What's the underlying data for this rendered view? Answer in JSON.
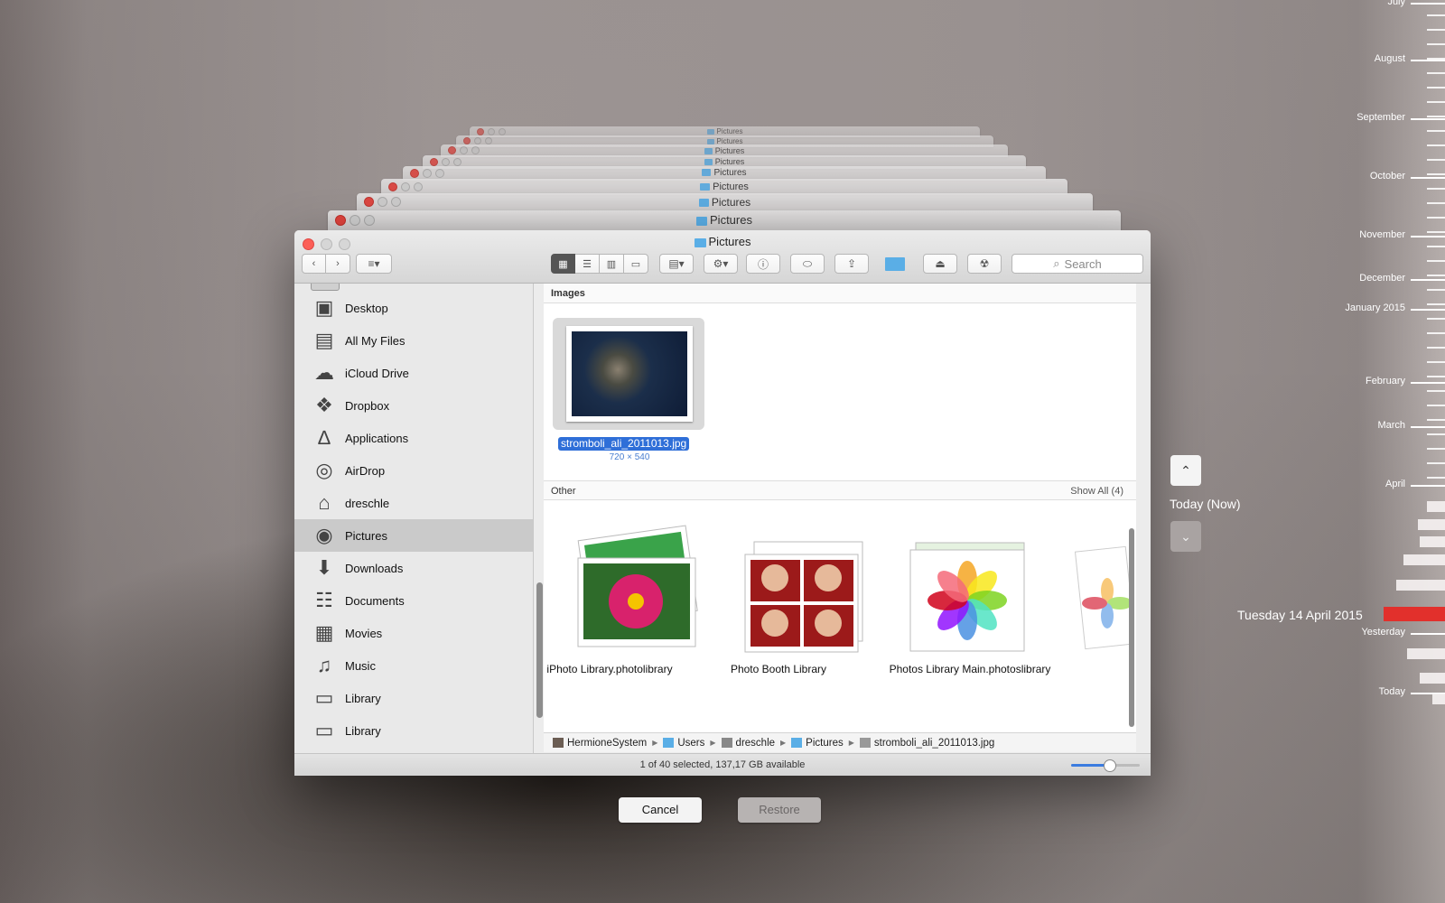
{
  "window": {
    "title": "Pictures",
    "back_window_title": "Pictures"
  },
  "toolbar": {
    "back_label": "<",
    "forward_label": ">",
    "view_modes": [
      "icon-view",
      "list-view",
      "column-view",
      "cover-flow-view"
    ],
    "search_placeholder": "Search"
  },
  "sidebar": {
    "items": [
      {
        "label": "Desktop",
        "icon": "desktop-icon"
      },
      {
        "label": "All My Files",
        "icon": "all-my-files-icon"
      },
      {
        "label": "iCloud Drive",
        "icon": "cloud-icon"
      },
      {
        "label": "Dropbox",
        "icon": "dropbox-icon"
      },
      {
        "label": "Applications",
        "icon": "applications-icon"
      },
      {
        "label": "AirDrop",
        "icon": "airdrop-icon"
      },
      {
        "label": "dreschle",
        "icon": "home-icon"
      },
      {
        "label": "Pictures",
        "icon": "camera-icon",
        "selected": true
      },
      {
        "label": "Downloads",
        "icon": "downloads-icon"
      },
      {
        "label": "Documents",
        "icon": "documents-icon"
      },
      {
        "label": "Movies",
        "icon": "movies-icon"
      },
      {
        "label": "Music",
        "icon": "music-icon"
      },
      {
        "label": "Library",
        "icon": "folder-icon"
      },
      {
        "label": "Library",
        "icon": "folder-icon"
      }
    ]
  },
  "content": {
    "images_header": "Images",
    "image_file": {
      "name": "stromboli_ali_2011013.jpg",
      "dims": "720 × 540"
    },
    "other_header": "Other",
    "show_all": "Show All (4)",
    "other_items": [
      {
        "name": "iPhoto Library.photolibrary"
      },
      {
        "name": "Photo Booth Library"
      },
      {
        "name": "Photos Library Main.photoslibrary"
      }
    ]
  },
  "pathbar": [
    "HermioneSystem",
    "Users",
    "dreschle",
    "Pictures",
    "stromboli_ali_2011013.jpg"
  ],
  "status": {
    "text": "1 of 40 selected, 137,17 GB available",
    "icon_size_fraction": 0.55
  },
  "buttons": {
    "cancel": "Cancel",
    "restore": "Restore"
  },
  "timemachine": {
    "now_label": "Today (Now)",
    "current_date": "Tuesday 14 April 2015",
    "months": [
      "July",
      "August",
      "September",
      "October",
      "November",
      "December",
      "January 2015",
      "February",
      "March",
      "April",
      "Yesterday",
      "Today"
    ]
  },
  "colors": {
    "accent": "#2f6fd8",
    "timeline_marker": "#e2302c"
  }
}
